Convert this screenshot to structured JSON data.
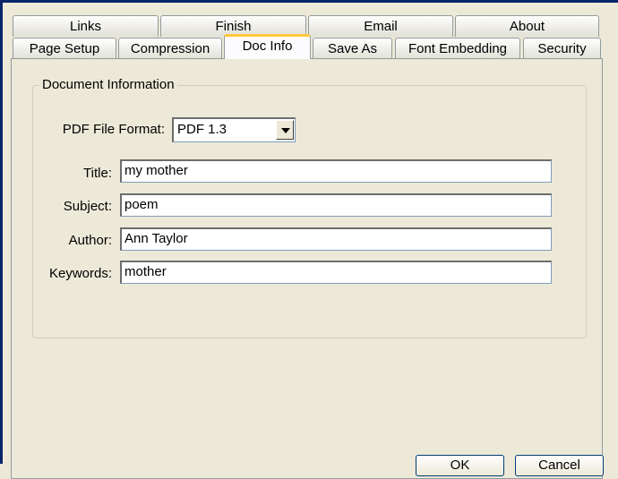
{
  "tabs_back": [
    "Links",
    "Finish",
    "Email",
    "About"
  ],
  "tabs_front": [
    "Page Setup",
    "Compression",
    "Doc Info",
    "Save As",
    "Font Embedding",
    "Security"
  ],
  "active_tab": "Doc Info",
  "group": {
    "title": "Document Information",
    "pdf_format_label": "PDF File Format:",
    "pdf_format_value": "PDF 1.3",
    "fields": [
      {
        "label": "Title:",
        "value": "my mother"
      },
      {
        "label": "Subject:",
        "value": "poem"
      },
      {
        "label": "Author:",
        "value": "Ann Taylor"
      },
      {
        "label": "Keywords:",
        "value": "mother"
      }
    ]
  },
  "buttons": {
    "ok": "OK",
    "cancel": "Cancel"
  }
}
